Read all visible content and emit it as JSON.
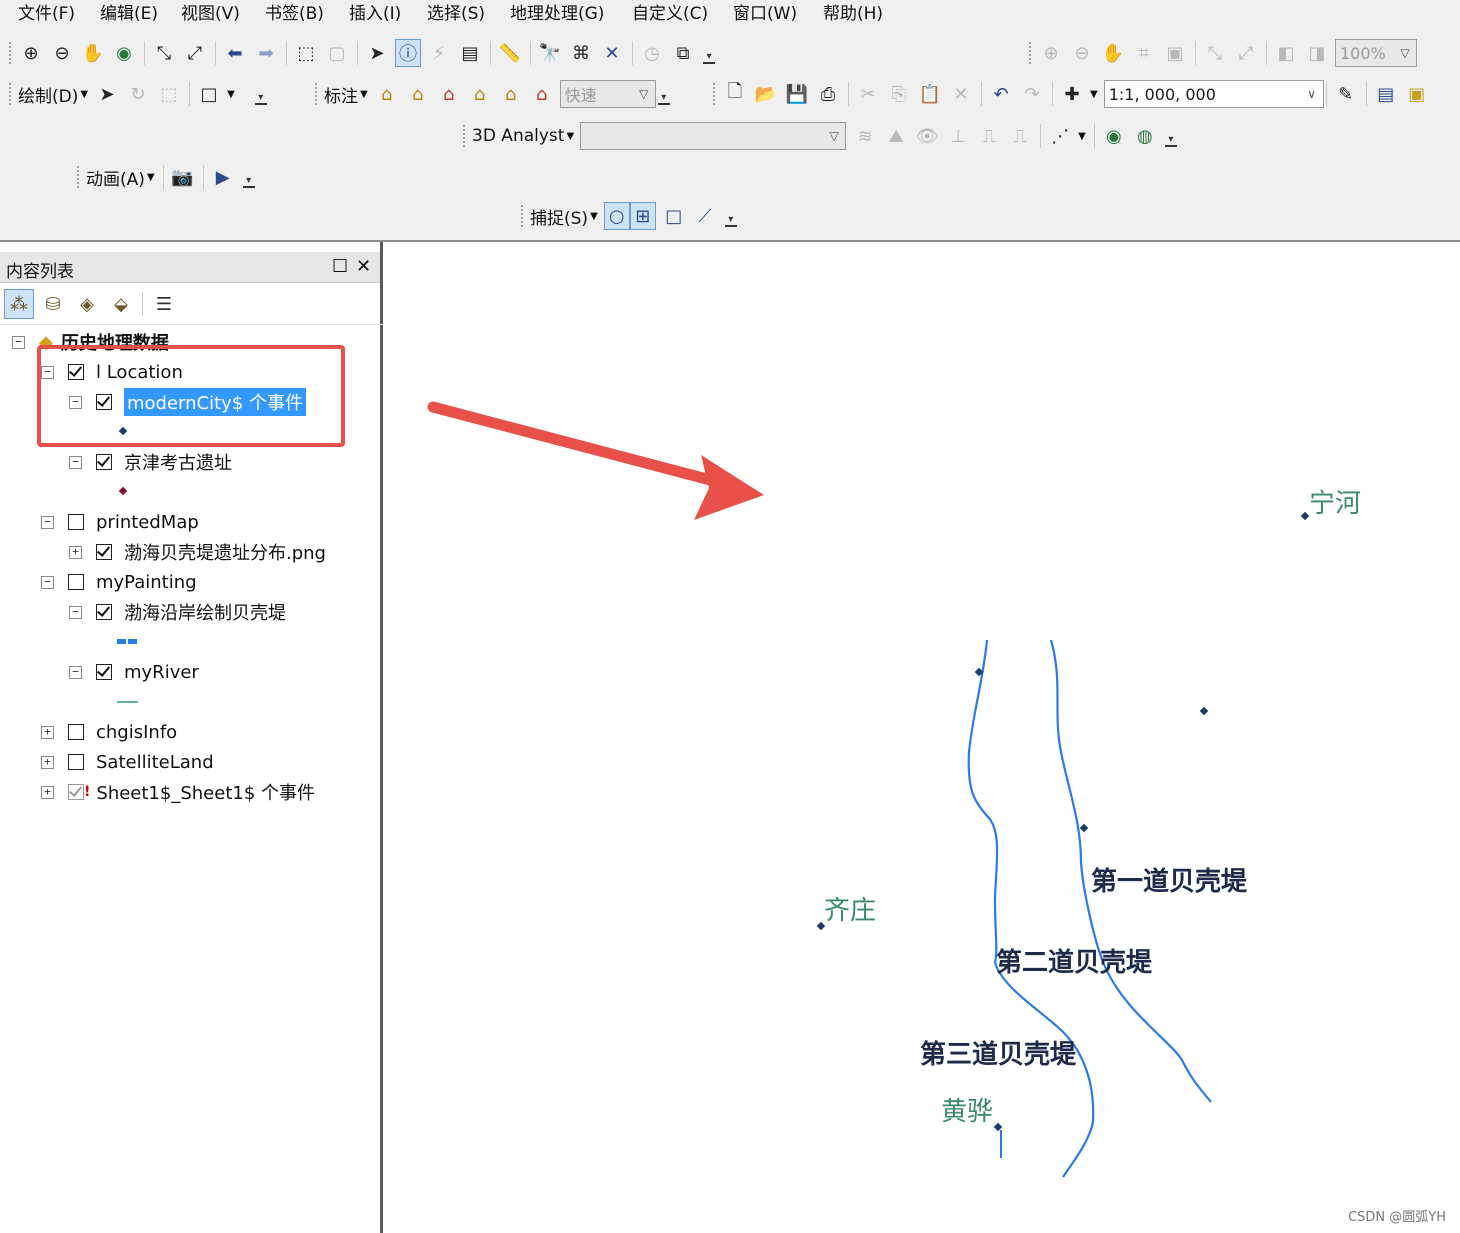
{
  "menu": [
    "文件(F)",
    "编辑(E)",
    "视图(V)",
    "书签(B)",
    "插入(I)",
    "选择(S)",
    "地理处理(G)",
    "自定义(C)",
    "窗口(W)",
    "帮助(H)"
  ],
  "toolbar": {
    "zoom_percent": "100%",
    "draw_label": "绘制(D)",
    "annotate_label": "标注",
    "quick_label": "快速",
    "scale": "1:1, 000, 000",
    "analyst_label": "3D Analyst",
    "animation_label": "动画(A)",
    "snapping_label": "捕捉(S)"
  },
  "toc": {
    "title": "内容列表",
    "group_name": "历史地理数据",
    "nodes": [
      {
        "label": "l Location"
      },
      {
        "label": "modernCity$ 个事件"
      },
      {
        "label": "京津考古遗址"
      },
      {
        "label": "printedMap"
      },
      {
        "label": "渤海贝壳堤遗址分布.png"
      },
      {
        "label": "myPainting"
      },
      {
        "label": "渤海沿岸绘制贝壳堤"
      },
      {
        "label": "myRiver"
      },
      {
        "label": "chgisInfo"
      },
      {
        "label": "SatelliteLand"
      },
      {
        "label": "Sheet1$_Sheet1$ 个事件"
      }
    ]
  },
  "map": {
    "places": [
      "宁河",
      "齐庄",
      "黄骅"
    ],
    "dikes": [
      "第一道贝壳堤",
      "第二道贝壳堤",
      "第三道贝壳堤"
    ]
  },
  "colors": {
    "selection": "#3399ff",
    "highlight_box": "#e8504a",
    "arrow": "#e8504a",
    "river": "#2a7ae8",
    "point": "#1e3a6a",
    "place_label": "#3a8a68",
    "dike_label": "#1e2a4a"
  },
  "watermark": "CSDN @圆弧YH"
}
